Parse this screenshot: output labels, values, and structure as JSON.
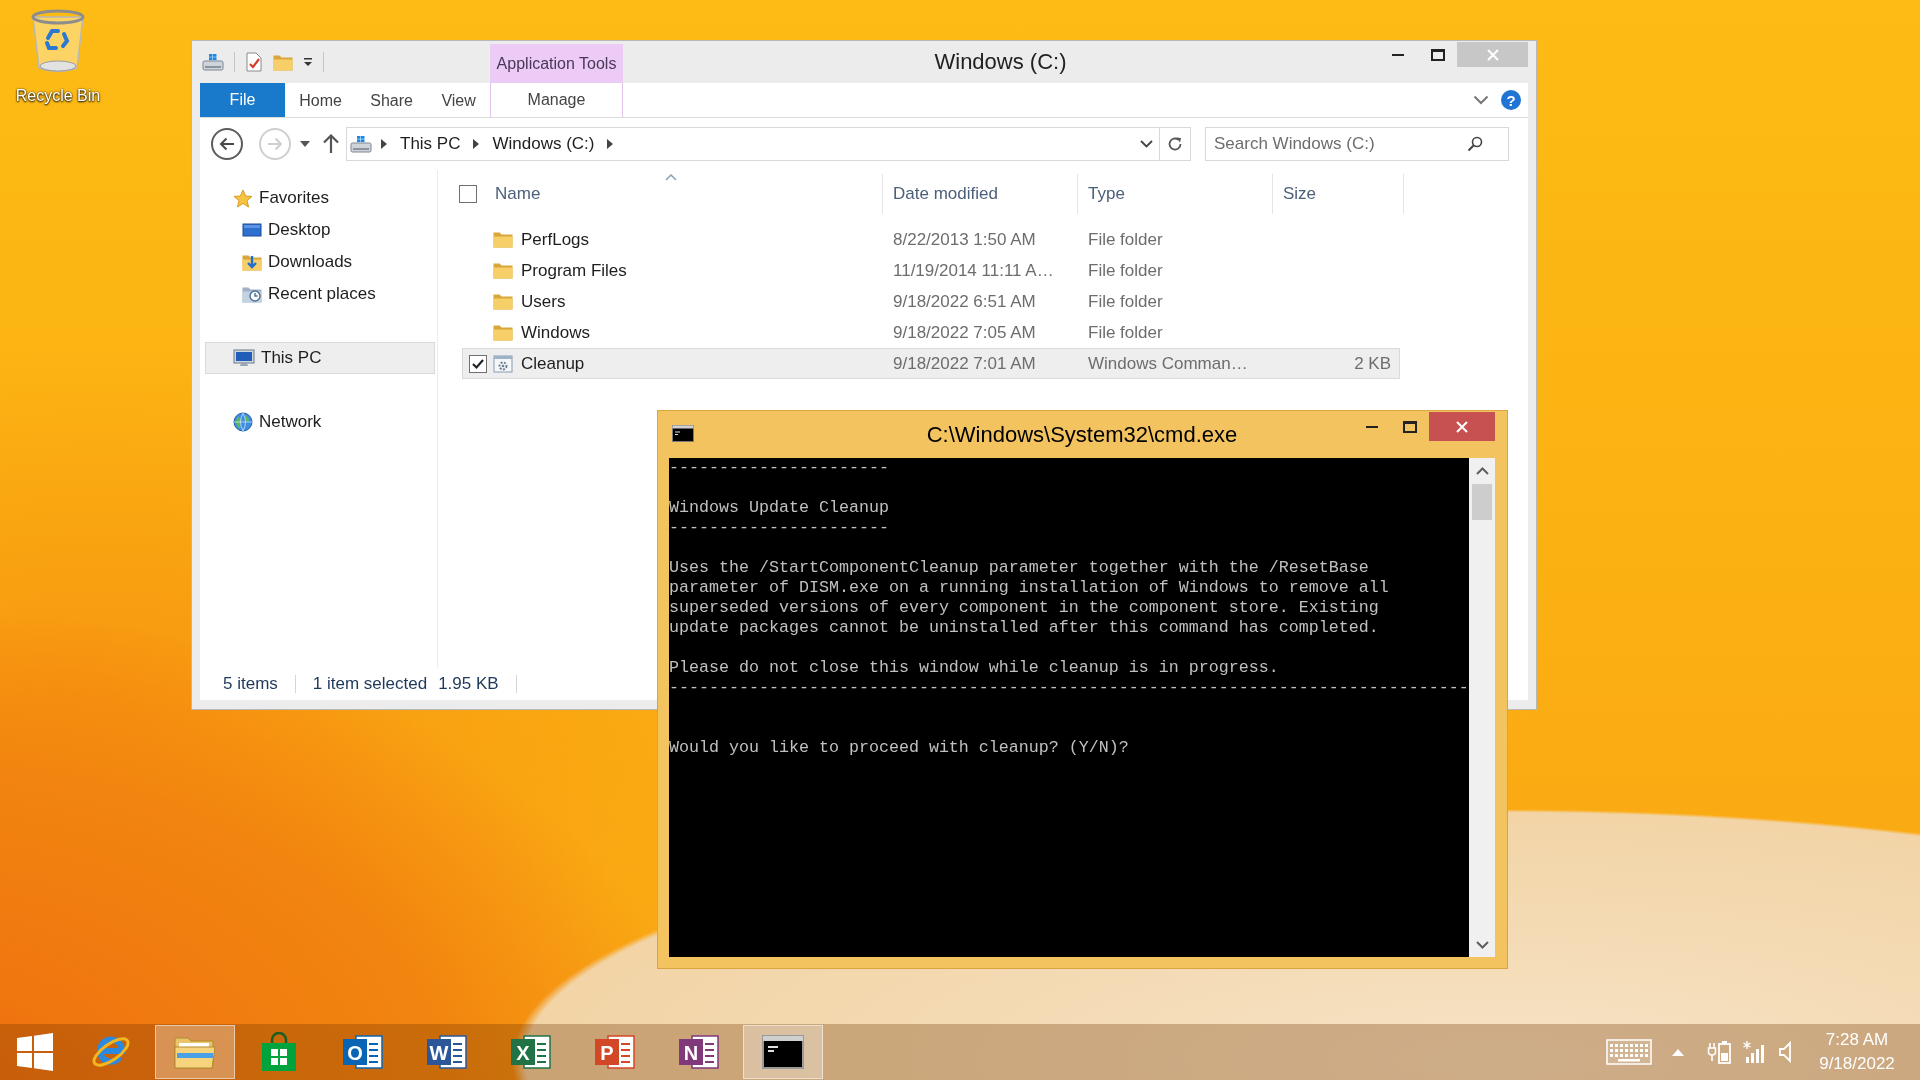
{
  "desktop_icons": [
    {
      "label": "Recycle Bin",
      "kind": "recycle-bin"
    }
  ],
  "explorer": {
    "title": "Windows (C:)",
    "active": false,
    "contextual_group": "Application Tools",
    "ribbon_tabs": [
      {
        "label": "File",
        "kind": "file",
        "selected": false
      },
      {
        "label": "Home",
        "kind": "tab",
        "selected": false
      },
      {
        "label": "Share",
        "kind": "tab",
        "selected": false
      },
      {
        "label": "View",
        "kind": "tab",
        "selected": false
      },
      {
        "label": "Manage",
        "kind": "contextual",
        "selected": false
      }
    ],
    "help": "?",
    "history_buttons": [
      {
        "kind": "back",
        "disabled": false
      },
      {
        "kind": "forward",
        "disabled": true
      }
    ],
    "breadcrumbs": [
      "This PC",
      "Windows (C:)"
    ],
    "search": {
      "placeholder": "Search Windows (C:)"
    },
    "navigation": [
      {
        "label": "Favorites",
        "kind": "favorites",
        "selected": false,
        "children": [
          {
            "label": "Desktop",
            "kind": "desktop",
            "selected": false
          },
          {
            "label": "Downloads",
            "kind": "downloads",
            "selected": false
          },
          {
            "label": "Recent places",
            "kind": "recent",
            "selected": false
          }
        ]
      },
      {
        "label": "This PC",
        "kind": "computer",
        "selected": true
      },
      {
        "label": "Network",
        "kind": "network",
        "selected": false
      }
    ],
    "columns": [
      {
        "label": "Name",
        "sorted": true
      },
      {
        "label": "Date modified",
        "sorted": false
      },
      {
        "label": "Type",
        "sorted": false
      },
      {
        "label": "Size",
        "sorted": false
      }
    ],
    "select_all": {
      "checked": false
    },
    "files": [
      {
        "name": "PerfLogs",
        "date_modified": "8/22/2013 1:50 AM",
        "type": "File folder",
        "kind": "folder",
        "selected": false
      },
      {
        "name": "Program Files",
        "date_modified": "11/19/2014 11:11 A…",
        "type": "File folder",
        "kind": "folder",
        "selected": false
      },
      {
        "name": "Users",
        "date_modified": "9/18/2022 6:51 AM",
        "type": "File folder",
        "kind": "folder",
        "selected": false
      },
      {
        "name": "Windows",
        "date_modified": "9/18/2022 7:05 AM",
        "type": "File folder",
        "kind": "folder",
        "selected": false
      },
      {
        "name": "Cleanup",
        "date_modified": "9/18/2022 7:01 AM",
        "type": "Windows Comman…",
        "size": "2 KB",
        "kind": "script",
        "selected": true
      }
    ],
    "status_bar": {
      "item_count": "5 items",
      "selection": "1 item selected",
      "selection_size": "1.95 KB"
    }
  },
  "console_window": {
    "title": "C:\\Windows\\System32\\cmd.exe",
    "active": true,
    "blocks": [
      {
        "texts": [
          "----------------------"
        ]
      },
      {
        "texts": [
          "Windows Update Cleanup",
          "----------------------"
        ]
      },
      {
        "paragraph": [
          "Uses the /StartComponentCleanup parameter together with the /ResetBase",
          "parameter of DISM.exe on a running installation of Windows to remove all",
          "superseded versions of every component in the component store. Existing",
          "update packages cannot be uninstalled after this command has completed."
        ]
      },
      {
        "texts": [
          "Please do not close this window while cleanup is in progress.",
          "--------------------------------------------------------------------------------"
        ]
      }
    ],
    "prompt": "Would you like to proceed with cleanup? (Y/N)?"
  },
  "taskbar": {
    "apps": [
      {
        "kind": "browser",
        "running": false
      },
      {
        "kind": "file-manager",
        "running": true
      },
      {
        "kind": "store",
        "running": false
      },
      {
        "kind": "mail",
        "letter": "O",
        "running": false
      },
      {
        "kind": "word-processor",
        "letter": "W",
        "running": false
      },
      {
        "kind": "spreadsheet",
        "letter": "X",
        "running": false
      },
      {
        "kind": "presentation",
        "letter": "P",
        "running": false
      },
      {
        "kind": "notes",
        "letter": "N",
        "running": false
      },
      {
        "kind": "command-prompt",
        "running": true
      }
    ],
    "clock": {
      "time": "7:28 AM",
      "date": "9/18/2022"
    }
  }
}
